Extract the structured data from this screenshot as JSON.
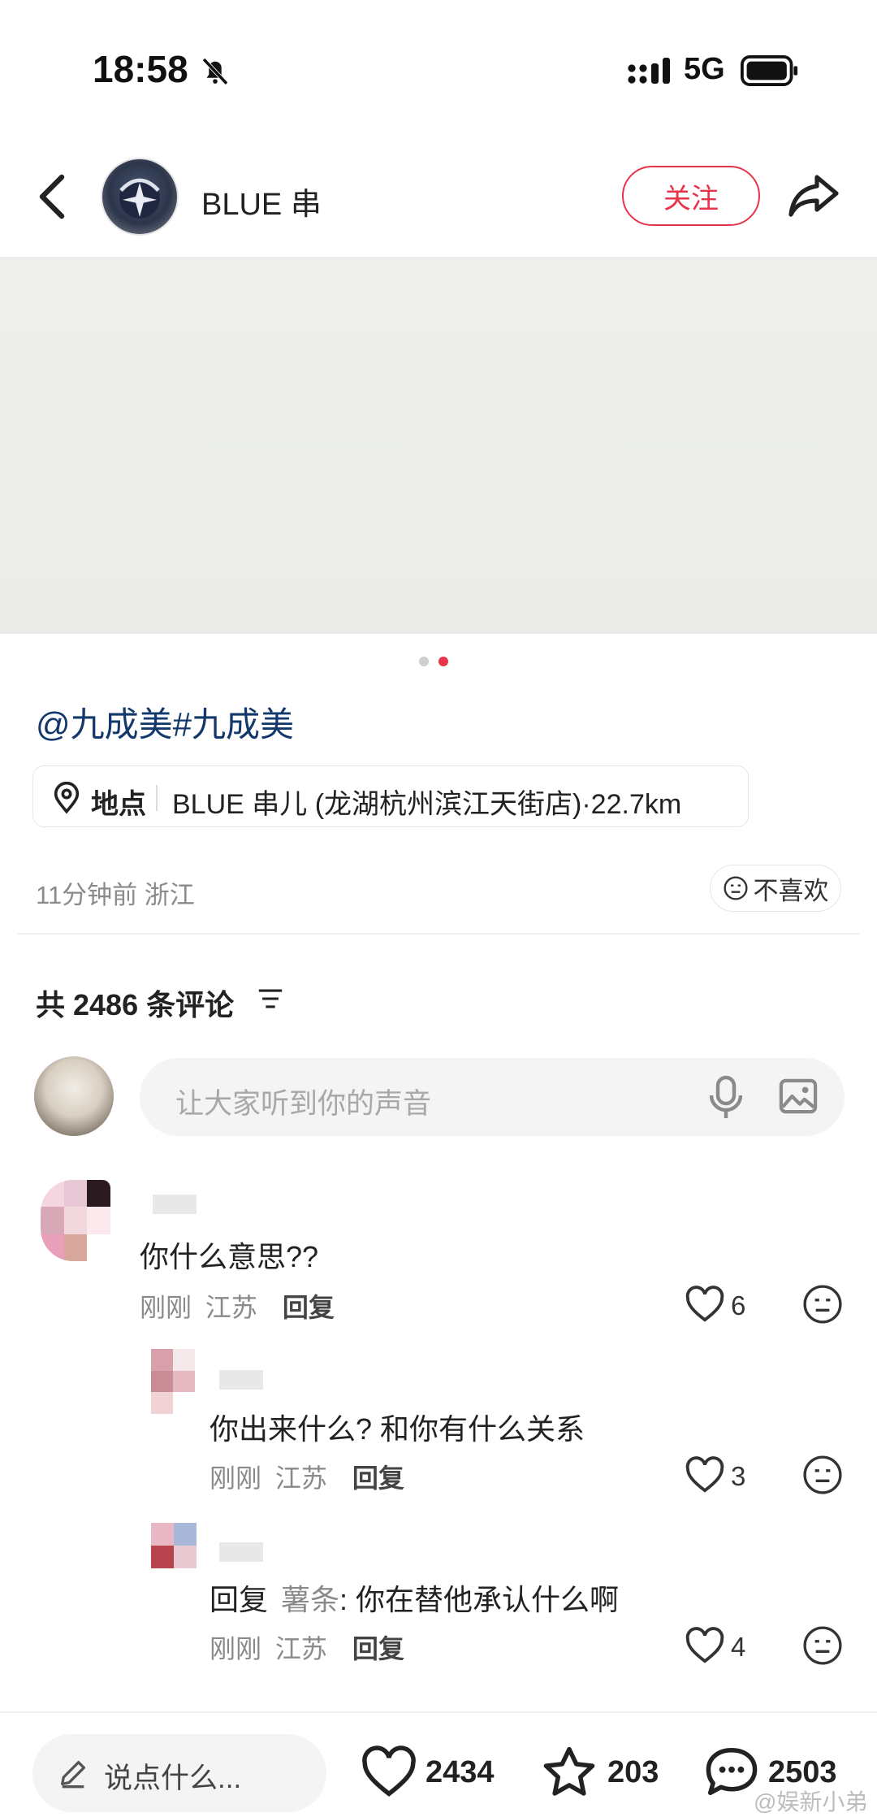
{
  "status_bar": {
    "time": "18:58",
    "network": "5G"
  },
  "header": {
    "author": "BLUE 串",
    "follow_label": "关注"
  },
  "post": {
    "caption": "@九成美#九成美",
    "location_label": "地点",
    "location_text": "BLUE 串儿 (龙湖杭州滨江天街店)·22.7km",
    "meta": "11分钟前  浙江",
    "dislike_label": "不喜欢"
  },
  "comments_section": {
    "count_label": "共 2486 条评论",
    "input_placeholder": "让大家听到你的声音",
    "comments": [
      {
        "text": "你什么意思??",
        "time": "刚刚",
        "region": "江苏",
        "reply_label": "回复",
        "likes": "6"
      },
      {
        "text": "你出来什么? 和你有什么关系",
        "time": "刚刚",
        "region": "江苏",
        "reply_label": "回复",
        "likes": "3"
      },
      {
        "reply_prefix": "回复",
        "reply_to": "薯条",
        "text": ": 你在替他承认什么啊",
        "time": "刚刚",
        "region": "江苏",
        "reply_label": "回复",
        "likes": "4"
      }
    ]
  },
  "bottom_bar": {
    "input_label": "说点什么...",
    "likes": "2434",
    "favorites": "203",
    "comments": "2503"
  },
  "watermark": "@娱新小弟",
  "colors": {
    "accent": "#e8344b",
    "mention": "#13386b"
  }
}
